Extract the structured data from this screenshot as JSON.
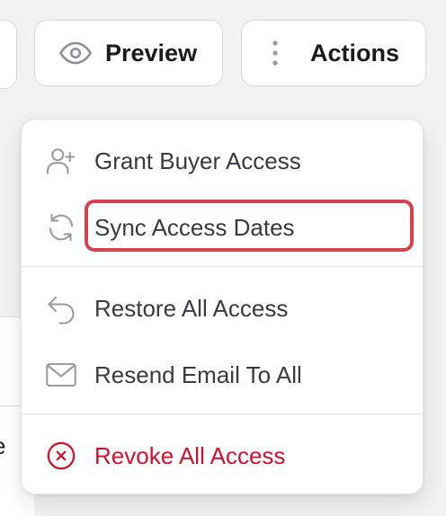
{
  "toolbar": {
    "preview_label": "Preview",
    "actions_label": "Actions",
    "preview_icon": "eye-icon",
    "actions_icon": "vertical-dots-icon"
  },
  "menu": {
    "items": [
      {
        "label": "Grant Buyer Access",
        "icon": "user-plus-icon"
      },
      {
        "label": "Sync Access Dates",
        "icon": "sync-icon",
        "highlighted": true
      },
      {
        "label": "Restore All Access",
        "icon": "undo-arrow-icon"
      },
      {
        "label": "Resend Email To All",
        "icon": "mail-icon"
      },
      {
        "label": "Revoke All Access",
        "icon": "x-circle-icon",
        "danger": true
      }
    ]
  },
  "background": {
    "partial_text": "e"
  },
  "colors": {
    "danger": "#d0112b",
    "highlight": "#d6404f",
    "icon_gray": "#9a9aa2",
    "text": "#3a3a3f"
  }
}
